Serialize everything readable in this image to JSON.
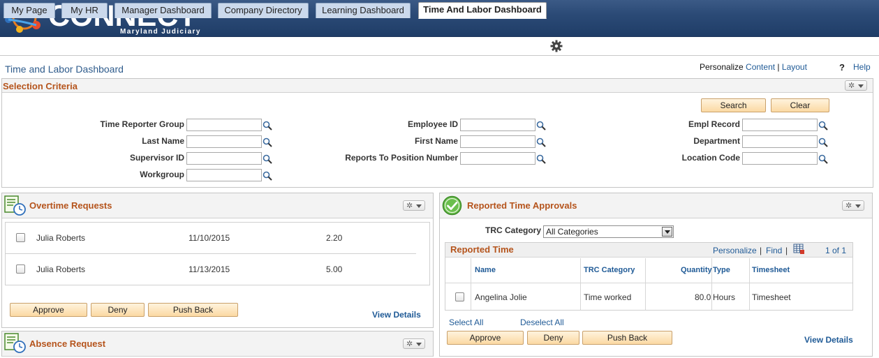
{
  "brand": {
    "name": "CONNECT",
    "subtitle": "Maryland Judiciary"
  },
  "colors": {
    "banner": "#2b4a76",
    "tab": "#cbd9ec",
    "accent": "#b5541c",
    "link": "#1f5a96",
    "button": "#fbd9a3"
  },
  "tabs": [
    {
      "label": "My Page"
    },
    {
      "label": "My HR"
    },
    {
      "label": "Manager Dashboard"
    },
    {
      "label": "Company Directory"
    },
    {
      "label": "Learning Dashboard"
    },
    {
      "label": "Time And Labor Dashboard",
      "active": true
    }
  ],
  "page": {
    "title": "Time and Labor Dashboard",
    "personalize_label": "Personalize",
    "content_link": "Content",
    "separator": "|",
    "layout_link": "Layout",
    "help_icon": "?",
    "help_link": "Help"
  },
  "selection": {
    "title": "Selection Criteria",
    "search_label": "Search",
    "clear_label": "Clear",
    "fields": {
      "time_reporter_group": {
        "label": "Time Reporter Group",
        "value": ""
      },
      "last_name": {
        "label": "Last Name",
        "value": ""
      },
      "supervisor_id": {
        "label": "Supervisor ID",
        "value": ""
      },
      "workgroup": {
        "label": "Workgroup",
        "value": ""
      },
      "employee_id": {
        "label": "Employee ID",
        "value": ""
      },
      "first_name": {
        "label": "First Name",
        "value": ""
      },
      "reports_to": {
        "label": "Reports To Position Number",
        "value": ""
      },
      "empl_record": {
        "label": "Empl Record",
        "value": ""
      },
      "department": {
        "label": "Department",
        "value": ""
      },
      "location_code": {
        "label": "Location Code",
        "value": ""
      }
    }
  },
  "overtime": {
    "title": "Overtime Requests",
    "rows": [
      {
        "name": "Julia Roberts",
        "date": "11/10/2015",
        "hours": "2.20"
      },
      {
        "name": "Julia Roberts",
        "date": "11/13/2015",
        "hours": "5.00"
      }
    ],
    "approve_label": "Approve",
    "deny_label": "Deny",
    "pushback_label": "Push Back",
    "view_details": "View Details"
  },
  "absence": {
    "title": "Absence Request"
  },
  "approvals": {
    "title": "Reported Time Approvals",
    "trc_label": "TRC Category",
    "trc_value": "All Categories",
    "grid_title": "Reported Time",
    "grid_personalize": "Personalize",
    "grid_find": "Find",
    "grid_sep": "|",
    "grid_count": "1 of 1",
    "columns": {
      "name": "Name",
      "trc": "TRC Category",
      "quantity": "Quantity",
      "type": "Type",
      "timesheet": "Timesheet"
    },
    "rows": [
      {
        "name": "Angelina Jolie",
        "trc": "Time worked",
        "quantity": "80.0",
        "type": "Hours",
        "timesheet": "Timesheet"
      }
    ],
    "select_all": "Select All",
    "deselect_all": "Deselect All",
    "approve_label": "Approve",
    "deny_label": "Deny",
    "pushback_label": "Push Back",
    "view_details": "View Details"
  }
}
